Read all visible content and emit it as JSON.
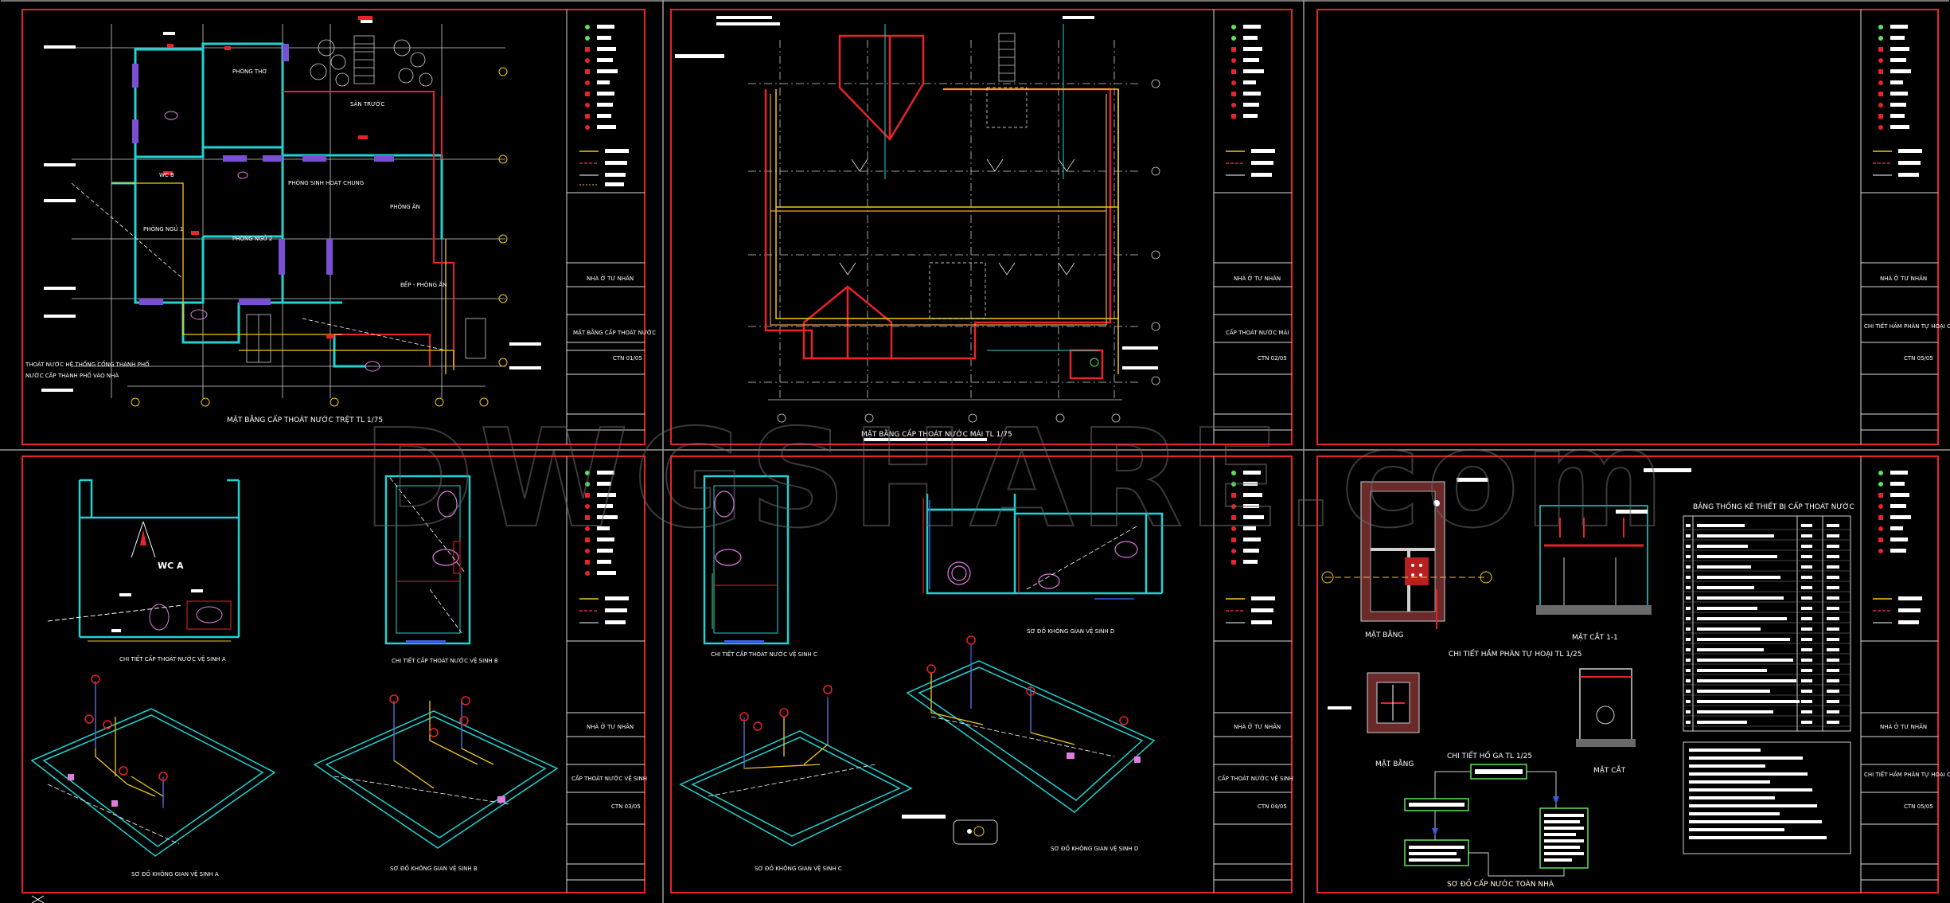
{
  "watermark": "DWGSHARE.com",
  "colors": {
    "frame": "#e8232a",
    "wall": "#1fd3d3",
    "pipe_cold": "#f2c81b",
    "pipe_hot": "#e8232a",
    "fixture": "#e07be0",
    "line": "#cfcfcf",
    "label_bg": "#ffffff"
  },
  "sheets": [
    {
      "id": "s1",
      "caption": "MẶT BẰNG CẤP THOÁT NƯỚC TRỆT TL 1/75",
      "room_labels": [
        "PHÒNG THỜ",
        "PHÒNG SINH HOẠT CHUNG",
        "PHÒNG NGỦ 1",
        "PHÒNG NGỦ 2",
        "PHÒNG ĂN",
        "WC B",
        "BẾP - PHÒNG ĂN",
        "SÂN TRƯỚC"
      ],
      "note_lines": [
        "THOÁT NƯỚC HỆ THỐNG CỐNG THÀNH PHỐ",
        "NƯỚC CẤP THÀNH PHỐ VÀO NHÀ"
      ],
      "titleblock": {
        "project": "NHÀ Ở TƯ NHÂN",
        "drawing": "MẶT BẰNG CẤP THOÁT NƯỚC",
        "sheet_no": "CTN 01/05"
      }
    },
    {
      "id": "s2",
      "caption": "MẶT BẰNG CẤP THOÁT NƯỚC MÁI TL 1/75",
      "room_labels": [],
      "note_lines": [],
      "titleblock": {
        "project": "NHÀ Ở TƯ NHÂN",
        "drawing": "CẤP THOÁT NƯỚC MÁI",
        "sheet_no": "CTN 02/05"
      }
    },
    {
      "id": "s3",
      "caption": "",
      "room_labels": [],
      "note_lines": [],
      "titleblock": {
        "project": "NHÀ Ở TƯ NHÂN",
        "drawing": "CHI TIẾT HẦM PHÂN TỰ HOẠI CHI TIẾT HỐ GA",
        "sheet_no": "CTN 05/05"
      }
    },
    {
      "id": "s4",
      "caption_a": "CHI TIẾT CẤP THOÁT NƯỚC VỆ SINH A",
      "caption_b": "CHI TIẾT CẤP THOÁT NƯỚC VỆ SINH B",
      "caption_c": "SƠ ĐỒ KHÔNG GIAN VỆ SINH A",
      "caption_d": "SƠ ĐỒ KHÔNG GIAN VỆ SINH B",
      "room_label": "WC A",
      "titleblock": {
        "project": "NHÀ Ở TƯ NHÂN",
        "drawing": "CẤP THOÁT NƯỚC VỆ SINH",
        "sheet_no": "CTN 03/05"
      }
    },
    {
      "id": "s5",
      "caption_a": "CHI TIẾT CẤP THOÁT NƯỚC VỆ SINH C",
      "caption_b": "SƠ ĐỒ KHÔNG GIAN VỆ SINH D",
      "caption_c": "SƠ ĐỒ KHÔNG GIAN VỆ SINH C",
      "caption_d": "SƠ ĐỒ KHÔNG GIAN VỆ SINH D",
      "titleblock": {
        "project": "NHÀ Ở TƯ NHÂN",
        "drawing": "CẤP THOÁT NƯỚC VỆ SINH",
        "sheet_no": "CTN 04/05"
      }
    },
    {
      "id": "s6",
      "label_matbang_1": "MẶT BẰNG",
      "label_matcat_1": "MẶT CẮT 1-1",
      "caption_tank": "CHI TIẾT HẦM PHÂN TỰ HOẠI TL 1/25",
      "label_matbang_2": "MẶT BẰNG",
      "caption_pit": "CHI TIẾT HỐ GA TL 1/25",
      "label_matcat_2": "MẶT CẮT",
      "table_title": "BẢNG THỐNG KÊ THIẾT BỊ CẤP THOÁT NƯỚC",
      "caption_schema": "SƠ ĐỒ CẤP NƯỚC TOÀN NHÀ",
      "titleblock": {
        "project": "NHÀ Ở TƯ NHÂN",
        "drawing": "CHI TIẾT HẦM PHÂN TỰ HOẠI CHI TIẾT HỐ GA",
        "sheet_no": "CTN 05/05"
      }
    }
  ]
}
